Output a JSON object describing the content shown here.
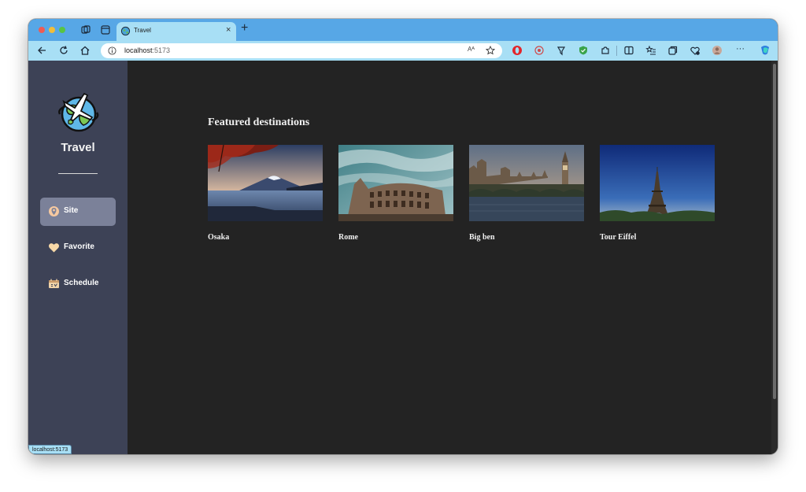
{
  "browser": {
    "tab_title": "Travel",
    "tab_close": "×",
    "new_tab": "+",
    "url_host": "localhost",
    "url_port": ":5173",
    "read_aloud": "Aᴬ",
    "status_url": "localhost:5173",
    "more": "···"
  },
  "sidebar": {
    "brand": "Travel",
    "items": [
      {
        "label": "Site",
        "icon": "location-pin-icon",
        "active": true
      },
      {
        "label": "Favorite",
        "icon": "heart-icon",
        "active": false
      },
      {
        "label": "Schedule",
        "icon": "calendar-icon",
        "active": false
      }
    ]
  },
  "main": {
    "heading": "Featured destinations",
    "destinations": [
      {
        "name": "Osaka",
        "image": "mountain-lake-photo"
      },
      {
        "name": "Rome",
        "image": "colosseum-photo"
      },
      {
        "name": "Big ben",
        "image": "westminster-bridge-photo"
      },
      {
        "name": "Tour Eiffel",
        "image": "eiffel-tower-photo"
      }
    ]
  },
  "colors": {
    "tab_bar": "#57a7e6",
    "toolbar": "#a8dff5",
    "sidebar": "#3d4256",
    "active_nav": "#7b8199",
    "content_bg": "#232323"
  }
}
